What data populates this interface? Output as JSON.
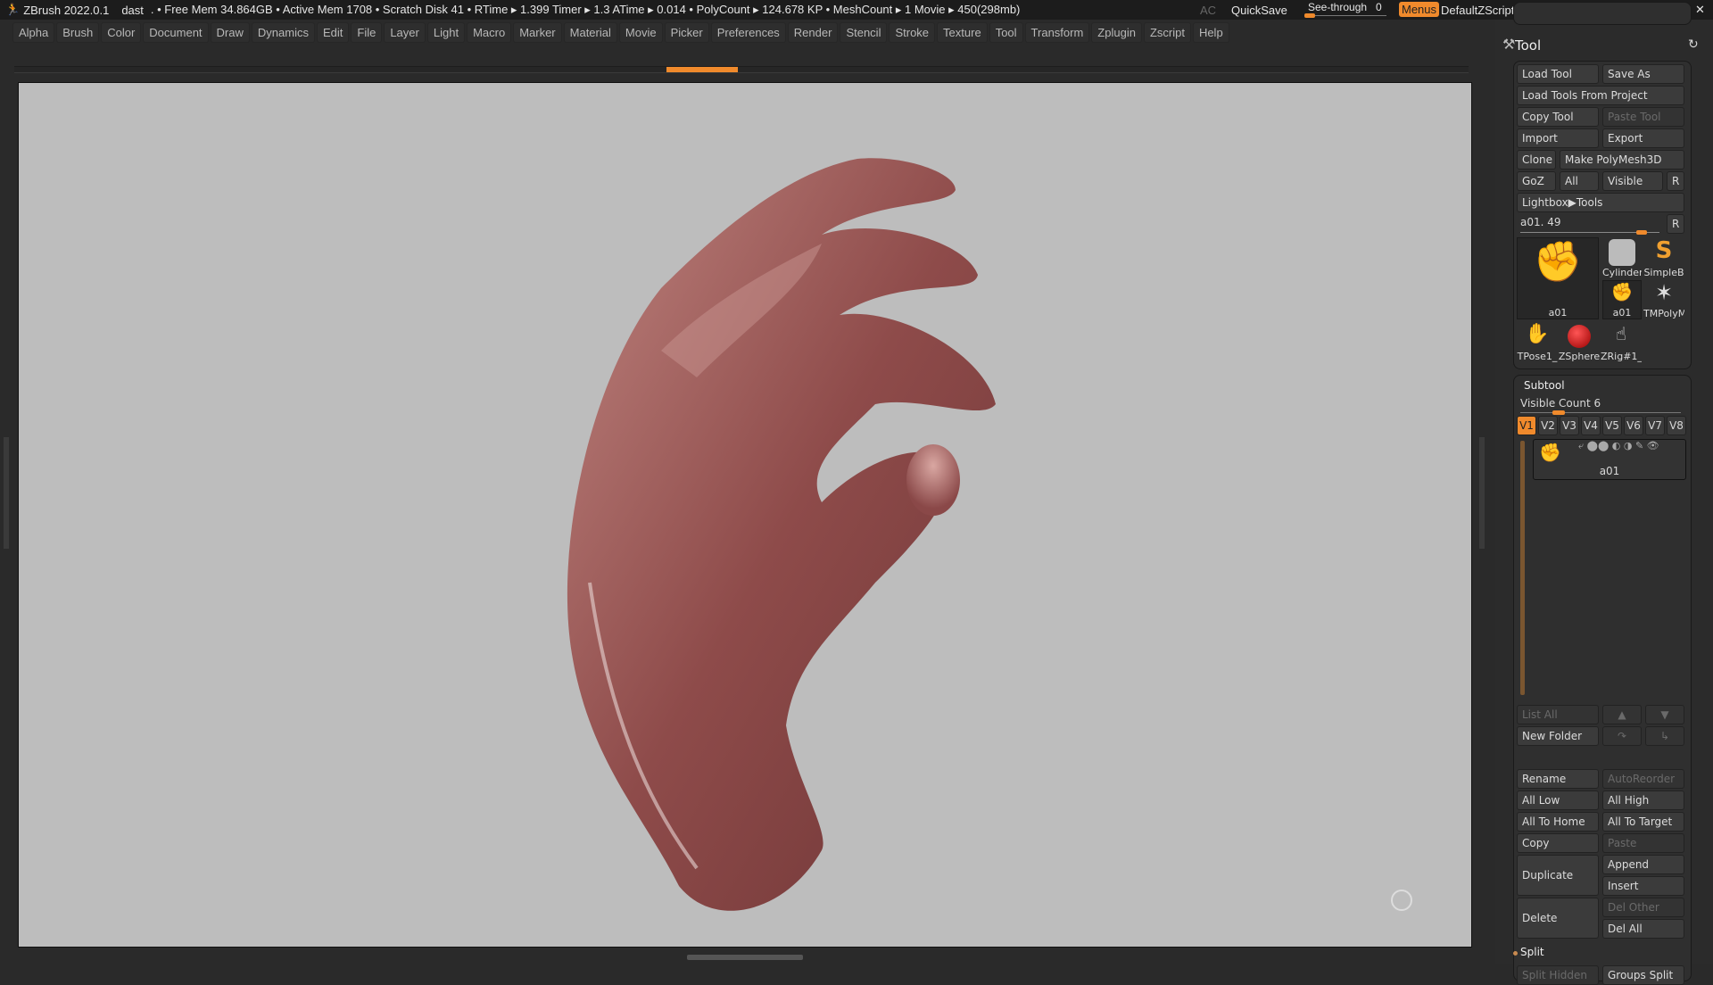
{
  "titlebar": {
    "app": "ZBrush 2022.0.1",
    "doc": "dast",
    "stats": ". • Free Mem 34.864GB • Active Mem 1708 • Scratch Disk 41 •  RTime ▸ 1.399 Timer ▸ 1.3 ATime ▸ 0.014 • PolyCount ▸ 124.678 KP  • MeshCount ▸ 1  Movie ▸ 450(298mb)",
    "ac": "AC",
    "quicksave": "QuickSave",
    "seethrough": "See-through",
    "seethrough_value": "0",
    "menus": "Menus",
    "defaultzscript": "DefaultZScript"
  },
  "menu": [
    "Alpha",
    "Brush",
    "Color",
    "Document",
    "Draw",
    "Dynamics",
    "Edit",
    "File",
    "Layer",
    "Light",
    "Macro",
    "Marker",
    "Material",
    "Movie",
    "Picker",
    "Preferences",
    "Render",
    "Stencil",
    "Stroke",
    "Texture",
    "Tool",
    "Transform",
    "Zplugin",
    "Zscript",
    "Help"
  ],
  "tool": {
    "title": "Tool",
    "load_tool": "Load Tool",
    "save_as": "Save As",
    "load_from_project": "Load Tools From Project",
    "copy_tool": "Copy Tool",
    "paste_tool": "Paste Tool",
    "import": "Import",
    "export": "Export",
    "clone": "Clone",
    "make_polymesh": "Make PolyMesh3D",
    "goz": "GoZ",
    "all": "All",
    "visible": "Visible",
    "r": "R",
    "lightbox_tools": "Lightbox▶Tools",
    "current": "a01. 49",
    "slider_fraction": 0.9,
    "thumbs": [
      "a01",
      "Cylinder",
      "SimpleB",
      "a01",
      "TMPolyM",
      "TPose1_",
      "ZSphere",
      "ZRig#1_"
    ]
  },
  "subtool": {
    "title": "Subtool",
    "visible_count": "Visible Count 6",
    "visible_count_value": 6,
    "versions": [
      "V1",
      "V2",
      "V3",
      "V4",
      "V5",
      "V6",
      "V7",
      "V8"
    ],
    "active_version": "V1",
    "item": "a01",
    "list_all": "List All",
    "new_folder": "New Folder",
    "rename": "Rename",
    "autoreorder": "AutoReorder",
    "all_low": "All Low",
    "all_high": "All High",
    "all_to_home": "All To Home",
    "all_to_target": "All To Target",
    "copy": "Copy",
    "paste": "Paste",
    "duplicate": "Duplicate",
    "append": "Append",
    "insert": "Insert",
    "delete": "Delete",
    "del_other": "Del Other",
    "del_all": "Del All",
    "split": "Split",
    "split_hidden": "Split Hidden",
    "groups_split": "Groups Split"
  },
  "colors": {
    "accent": "#f08a2c",
    "canvas": "#bdbdbd",
    "skin": "#9a5a58"
  }
}
